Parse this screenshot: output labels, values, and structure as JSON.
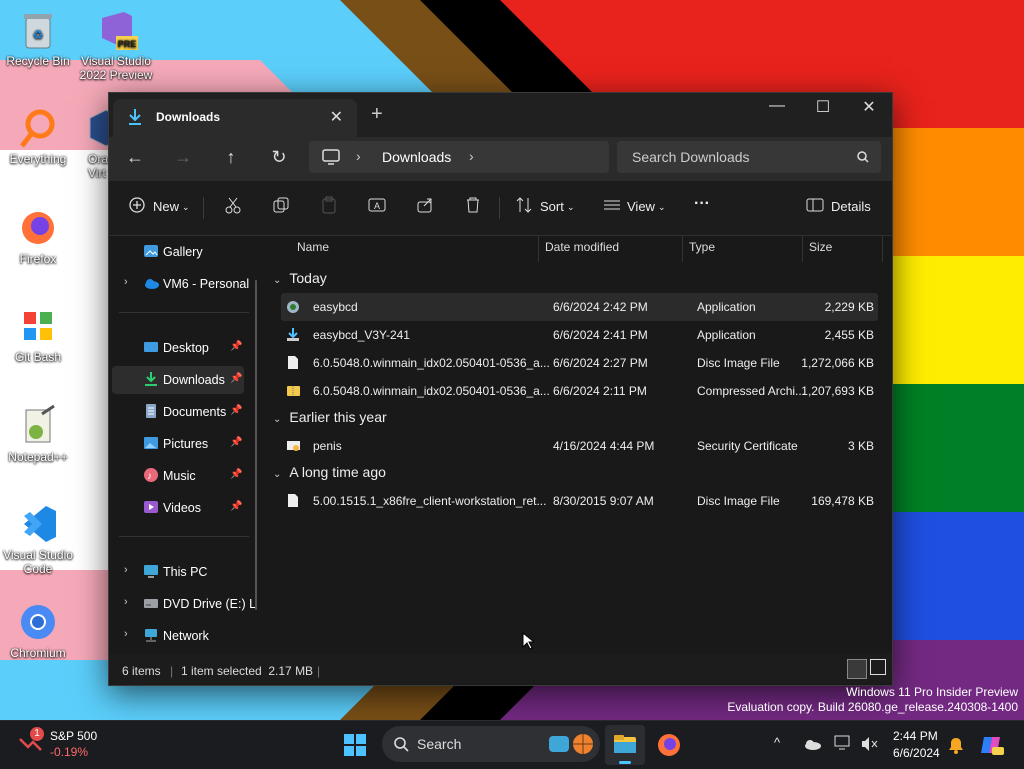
{
  "desktop": {
    "icons": [
      {
        "label": "Recycle Bin"
      },
      {
        "label": "Visual Studio 2022 Preview",
        "badge": "PRE"
      },
      {
        "label": "Everything"
      },
      {
        "label": "Ora Virt"
      },
      {
        "label": "Firefox"
      },
      {
        "label": "Git Bash"
      },
      {
        "label": "Notepad++"
      },
      {
        "label": "Visual Studio Code"
      },
      {
        "label": "Chromium"
      }
    ]
  },
  "window": {
    "tab_title": "Downloads",
    "breadcrumb": "Downloads",
    "search_placeholder": "Search Downloads",
    "toolbar": {
      "new_label": "New",
      "sort_label": "Sort",
      "view_label": "View",
      "more_label": "···",
      "details_label": "Details"
    },
    "sidebar": {
      "gallery": "Gallery",
      "cloud": "VM6 - Personal",
      "quick": [
        {
          "label": "Desktop"
        },
        {
          "label": "Downloads"
        },
        {
          "label": "Documents"
        },
        {
          "label": "Pictures"
        },
        {
          "label": "Music"
        },
        {
          "label": "Videos"
        }
      ],
      "this_pc": "This PC",
      "dvd": "DVD Drive (E:) L",
      "network": "Network"
    },
    "columns": {
      "name": "Name",
      "date": "Date modified",
      "type": "Type",
      "size": "Size"
    },
    "groups": [
      {
        "title": "Today",
        "files": [
          {
            "name": "easybcd",
            "date": "6/6/2024 2:42 PM",
            "type": "Application",
            "size": "2,229 KB"
          },
          {
            "name": "easybcd_V3Y-241",
            "date": "6/6/2024 2:41 PM",
            "type": "Application",
            "size": "2,455 KB"
          },
          {
            "name": "6.0.5048.0.winmain_idx02.050401-0536_a...",
            "date": "6/6/2024 2:27 PM",
            "type": "Disc Image File",
            "size": "1,272,066 KB"
          },
          {
            "name": "6.0.5048.0.winmain_idx02.050401-0536_a...",
            "date": "6/6/2024 2:11 PM",
            "type": "Compressed Archi...",
            "size": "1,207,693 KB"
          }
        ]
      },
      {
        "title": "Earlier this year",
        "files": [
          {
            "name": "penis",
            "date": "4/16/2024 4:44 PM",
            "type": "Security Certificate",
            "size": "3 KB"
          }
        ]
      },
      {
        "title": "A long time ago",
        "files": [
          {
            "name": "5.00.1515.1_x86fre_client-workstation_ret...",
            "date": "8/30/2015 9:07 AM",
            "type": "Disc Image File",
            "size": "169,478 KB"
          }
        ]
      }
    ],
    "status": {
      "items": "6 items",
      "selected": "1 item selected  2.17 MB"
    }
  },
  "watermark": {
    "line1": "Windows 11 Pro Insider Preview",
    "line2": "Evaluation copy. Build 26080.ge_release.240308-1400"
  },
  "taskbar": {
    "stock_name": "S&P 500",
    "stock_change": "-0.19%",
    "stock_badge": "1",
    "search_label": "Search",
    "time": "2:44 PM",
    "date": "6/6/2024"
  },
  "colors": {
    "accent": "#4cc2ff",
    "window_bg": "#191919",
    "taskbar_bg": "#1b1c1f",
    "stock_down": "#ff6b6b"
  }
}
